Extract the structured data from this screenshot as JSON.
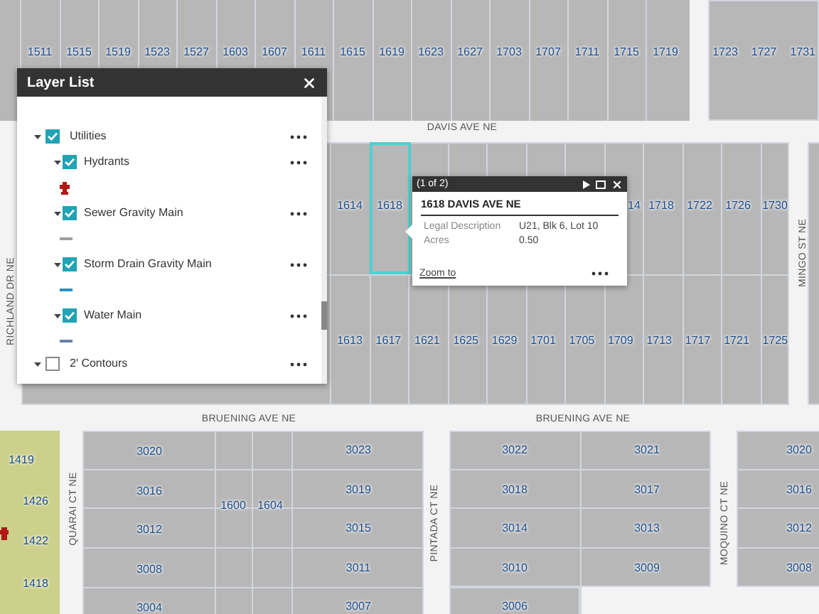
{
  "map": {
    "north_block": [
      "1511",
      "1515",
      "1519",
      "1523",
      "1527",
      "1603",
      "1607",
      "1611",
      "1615",
      "1619",
      "1623",
      "1627",
      "1703",
      "1707",
      "1711",
      "1715",
      "1719"
    ],
    "northeast_block": [
      "1723",
      "1727",
      "1731"
    ],
    "middle_block_north_row": [
      {
        "label": "1614",
        "selected": false
      },
      {
        "label": "1618",
        "selected": true
      },
      {
        "label": "14",
        "selected": false
      },
      {
        "label": "1718",
        "selected": false
      },
      {
        "label": "1722",
        "selected": false
      },
      {
        "label": "1726",
        "selected": false
      },
      {
        "label": "1730",
        "selected": false
      }
    ],
    "middle_block_south_row": [
      "1613",
      "1617",
      "1621",
      "1625",
      "1629",
      "1701",
      "1705",
      "1709",
      "1713",
      "1717",
      "1721",
      "1725"
    ],
    "west_area": [
      "1419",
      "1426",
      "1422",
      "1418"
    ],
    "south_block_1": {
      "west_column": [
        "3020",
        "3016",
        "3012",
        "3008",
        "3004"
      ],
      "middle": [
        "1600",
        "1604"
      ],
      "east_column": [
        "3023",
        "3019",
        "3015",
        "3011",
        "3007"
      ]
    },
    "south_block_2": {
      "west_column": [
        "3022",
        "3018",
        "3014",
        "3010",
        "3006"
      ],
      "east_column": [
        "3021",
        "3017",
        "3013",
        "3009"
      ]
    },
    "south_block_3": [
      "3020",
      "3016",
      "3012",
      "3008"
    ],
    "streets": [
      {
        "name": "DAVIS AVE NE",
        "kind": "horizontal"
      },
      {
        "name": "BRUENING AVE NE",
        "kind": "horizontal"
      },
      {
        "name": "BRUENING AVE NE",
        "kind": "horizontal"
      },
      {
        "name": "RICHLAND DR NE",
        "kind": "vertical"
      },
      {
        "name": "MINGO ST NE",
        "kind": "vertical"
      },
      {
        "name": "QUARAI CT NE",
        "kind": "vertical"
      },
      {
        "name": "PINTADA CT NE",
        "kind": "vertical"
      },
      {
        "name": "MOQUINO CT NE",
        "kind": "vertical"
      }
    ]
  },
  "layer_list": {
    "title": "Layer List",
    "layers": [
      {
        "label": "Utilities",
        "checked": true,
        "expanded": true,
        "children": [
          {
            "label": "Hydrants",
            "checked": true,
            "expanded": true,
            "legend": {
              "kind": "symbol",
              "color": "#b01818"
            }
          },
          {
            "label": "Sewer Gravity Main",
            "checked": true,
            "expanded": true,
            "legend": {
              "kind": "line",
              "color": "#a0a0a0"
            }
          },
          {
            "label": "Storm Drain Gravity Main",
            "checked": true,
            "expanded": true,
            "legend": {
              "kind": "line",
              "color": "#2a8fc0"
            }
          },
          {
            "label": "Water Main",
            "checked": true,
            "expanded": true,
            "legend": {
              "kind": "line",
              "color": "#6c7fa6"
            }
          }
        ]
      },
      {
        "label": "2' Contours",
        "checked": false,
        "expanded": true
      }
    ]
  },
  "popup": {
    "counter": "(1 of 2)",
    "title": "1618 DAVIS AVE NE",
    "fields": [
      {
        "label": "Legal Description",
        "value": "U21, Blk 6, Lot 10"
      },
      {
        "label": "Acres",
        "value": "0.50"
      }
    ],
    "action": "Zoom to"
  }
}
